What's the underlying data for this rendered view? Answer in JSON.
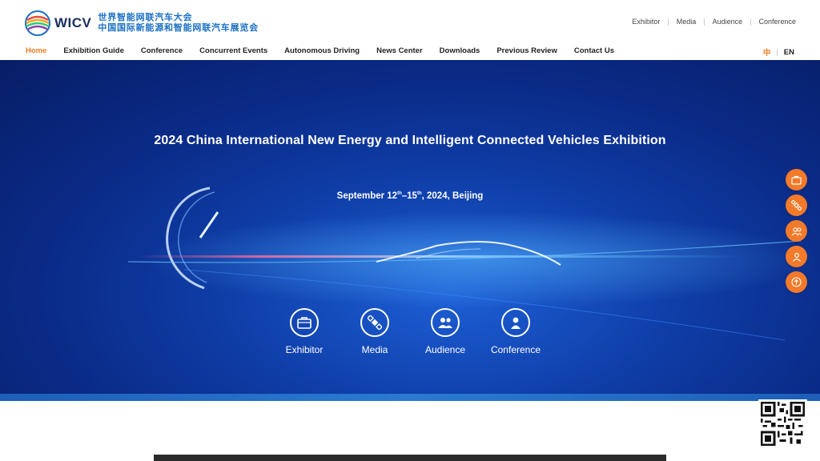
{
  "logo": {
    "word": "WICV",
    "cn_line1": "世界智能网联汽车大会",
    "cn_line2": "中国国际新能源和智能网联汽车展览会",
    "icon": "wicv-logo-icon"
  },
  "top_links": [
    "Exhibitor",
    "Media",
    "Audience",
    "Conference"
  ],
  "nav": {
    "items": [
      {
        "label": "Home",
        "active": true
      },
      {
        "label": "Exhibition Guide",
        "active": false
      },
      {
        "label": "Conference",
        "active": false
      },
      {
        "label": "Concurrent Events",
        "active": false
      },
      {
        "label": "Autonomous Driving",
        "active": false
      },
      {
        "label": "News Center",
        "active": false
      },
      {
        "label": "Downloads",
        "active": false
      },
      {
        "label": "Previous Review",
        "active": false
      },
      {
        "label": "Contact Us",
        "active": false
      }
    ]
  },
  "lang": {
    "zh": "中",
    "en": "EN"
  },
  "hero": {
    "title": "2024 China International New Energy and Intelligent Connected Vehicles Exhibition",
    "date_prefix": "September 12",
    "date_sup1": "th",
    "date_mid": "–15",
    "date_sup2": "th",
    "date_suffix": ", 2024, Beijing"
  },
  "features": [
    {
      "label": "Exhibitor",
      "icon": "briefcase-icon"
    },
    {
      "label": "Media",
      "icon": "satellite-icon"
    },
    {
      "label": "Audience",
      "icon": "group-icon"
    },
    {
      "label": "Conference",
      "icon": "person-icon"
    }
  ],
  "float_buttons": [
    "briefcase-icon",
    "satellite-icon",
    "group-icon",
    "person-icon",
    "arrow-up-icon"
  ],
  "colors": {
    "accent": "#f07a20",
    "brand_blue": "#1a6fc4",
    "hero_blue": "#0f3ea8"
  }
}
